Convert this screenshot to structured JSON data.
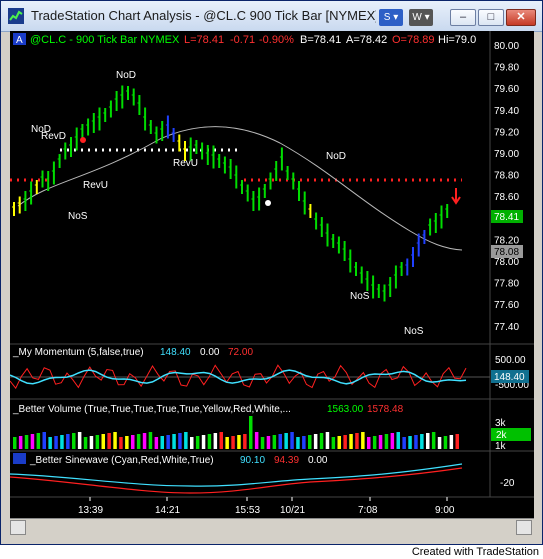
{
  "window": {
    "title": "TradeStation Chart Analysis - @CL.C 900 Tick Bar [NYMEX] C...",
    "dropdown_s": "S",
    "dropdown_w": "W",
    "min_label": "–",
    "max_label": "□",
    "close_label": "✕",
    "credit": "Created with TradeStation"
  },
  "price_header": {
    "badge": "A",
    "symbol": "@CL.C - 900 Tick Bar NYMEX",
    "last": "L=78.41",
    "chg": "-0.71",
    "pct": "-0.90%",
    "bid": "B=78.41",
    "ask": "A=78.42",
    "open": "O=78.89",
    "high": "Hi=79.0"
  },
  "price_axis": [
    "80.00",
    "79.80",
    "79.60",
    "79.40",
    "79.20",
    "79.00",
    "78.80",
    "78.60",
    "78.40",
    "78.20",
    "78.00",
    "77.80",
    "77.60",
    "77.40"
  ],
  "price_tags": {
    "last": "78.41",
    "ma": "78.08"
  },
  "annotations": {
    "nod1": "NoD",
    "nod2": "NoD",
    "nod3": "NoD",
    "revd": "RevD",
    "revu1": "RevU",
    "revu2": "RevU",
    "nos1": "NoS",
    "nos2": "NoS",
    "nos3": "NoS"
  },
  "momentum": {
    "title": "_My Momentum (5,false,true)",
    "v1": "148.40",
    "v2": "0.00",
    "v3": "72.00",
    "axis_top": "500.00",
    "tag": "148.40",
    "axis_bottom": "-500.00"
  },
  "volume": {
    "title": "_Better Volume (True,True,True,True,True,Yellow,Red,White,...",
    "v1": "1563.00",
    "v2": "1578.48",
    "axis_top": "3k",
    "tag": "2k",
    "axis_bottom": "1k"
  },
  "sinewave": {
    "title": "_Better Sinewave (Cyan,Red,White,True)",
    "v1": "90.10",
    "v2": "94.39",
    "v3": "0.00",
    "axis": "-20"
  },
  "time_axis": [
    "13:39",
    "14:21",
    "15:53",
    "10/21",
    "7:08",
    "9:00"
  ],
  "colors": {
    "up": "#00ff00",
    "down": "#00ff00",
    "text_green": "#00ff00",
    "text_red": "#ff3030",
    "text_cyan": "#40e0ff"
  }
}
